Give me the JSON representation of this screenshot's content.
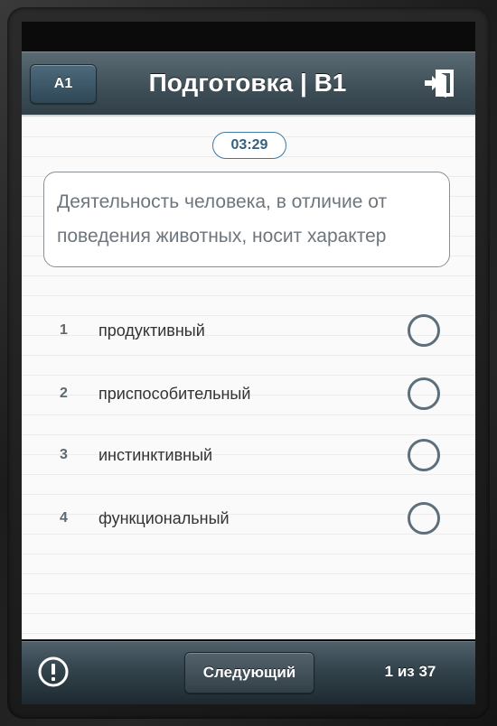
{
  "header": {
    "level_label": "A1",
    "title": "Подготовка | В1",
    "exit_icon": "exit-icon"
  },
  "timer": {
    "value": "03:29"
  },
  "question": {
    "text": "Деятельность человека, в отличие от поведения животных, носит характер"
  },
  "options": [
    {
      "number": "1",
      "text": "продуктивный"
    },
    {
      "number": "2",
      "text": "приспособительный"
    },
    {
      "number": "3",
      "text": "инстинктивный"
    },
    {
      "number": "4",
      "text": "функциональный"
    }
  ],
  "footer": {
    "report_icon": "exclamation-icon",
    "next_label": "Следующий",
    "progress": "1 из 37"
  },
  "colors": {
    "accent": "#3c7aa6",
    "radio": "#5d6f7a",
    "header_dark": "#25323a"
  }
}
